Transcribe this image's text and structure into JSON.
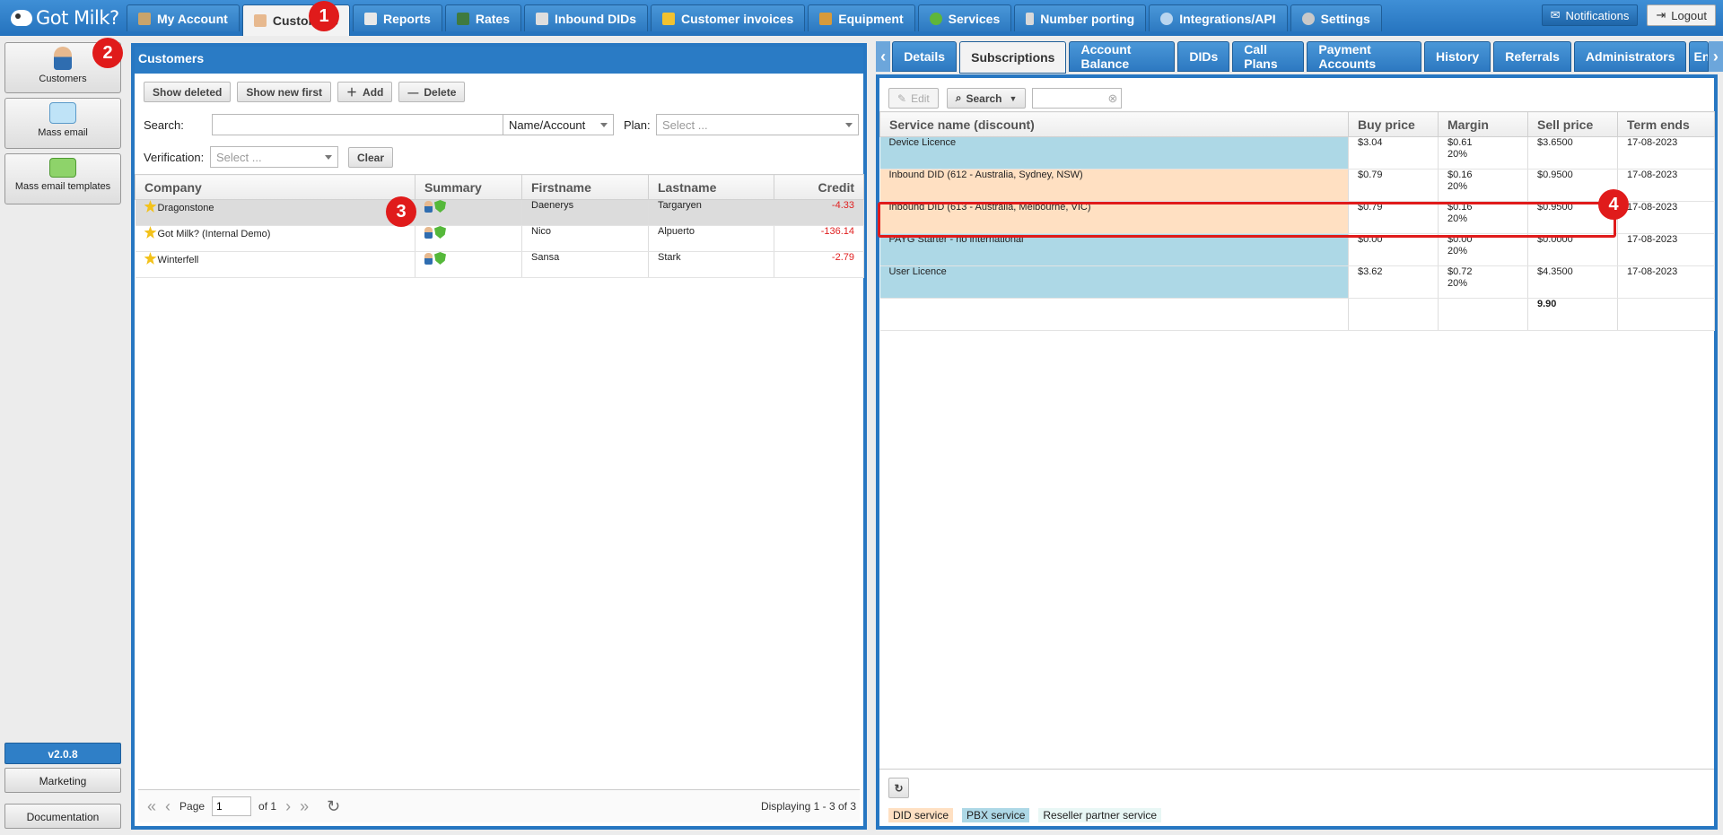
{
  "app": {
    "logo_text": "Got Milk?"
  },
  "top_tabs": [
    {
      "label": "My Account",
      "icon": "account-icon"
    },
    {
      "label": "Customers",
      "icon": "user-icon"
    },
    {
      "label": "Reports",
      "icon": "report-icon"
    },
    {
      "label": "Rates",
      "icon": "rates-icon"
    },
    {
      "label": "Inbound DIDs",
      "icon": "did-icon"
    },
    {
      "label": "Customer invoices",
      "icon": "invoice-icon"
    },
    {
      "label": "Equipment",
      "icon": "box-icon"
    },
    {
      "label": "Services",
      "icon": "services-icon"
    },
    {
      "label": "Number porting",
      "icon": "phone-icon"
    },
    {
      "label": "Integrations/API",
      "icon": "integration-icon"
    },
    {
      "label": "Settings",
      "icon": "gear-icon"
    }
  ],
  "top_right": {
    "notifications": "Notifications",
    "logout": "Logout"
  },
  "left_nav": {
    "items": [
      {
        "label": "Customers",
        "icon": "customers-icon"
      },
      {
        "label": "Mass email",
        "icon": "mass-email-icon"
      },
      {
        "label": "Mass email templates",
        "icon": "email-template-icon"
      }
    ],
    "version": "v2.0.8",
    "marketing": "Marketing",
    "documentation": "Documentation"
  },
  "customers_panel": {
    "title": "Customers",
    "buttons": {
      "show_deleted": "Show deleted",
      "show_new_first": "Show new first",
      "add": "Add",
      "delete": "Delete"
    },
    "search_label": "Search:",
    "search_value": "",
    "search_mode": "Name/Account",
    "plan_label": "Plan:",
    "plan_placeholder": "Select ...",
    "verification_label": "Verification:",
    "verification_placeholder": "Select ...",
    "clear": "Clear",
    "columns": [
      "Company",
      "Summary",
      "Firstname",
      "Lastname",
      "Credit"
    ],
    "rows": [
      {
        "company": "Dragonstone",
        "firstname": "Daenerys",
        "lastname": "Targaryen",
        "credit": "-4.33"
      },
      {
        "company": "Got Milk? (Internal Demo)",
        "firstname": "Nico",
        "lastname": "Alpuerto",
        "credit": "-136.14"
      },
      {
        "company": "Winterfell",
        "firstname": "Sansa",
        "lastname": "Stark",
        "credit": "-2.79"
      }
    ],
    "pager": {
      "page_label": "Page",
      "page": "1",
      "of": "of 1",
      "display": "Displaying 1 - 3 of 3"
    }
  },
  "right_tabs": [
    "Details",
    "Subscriptions",
    "Account Balance",
    "DIDs",
    "Call Plans",
    "Payment Accounts",
    "History",
    "Referrals",
    "Administrators",
    "En"
  ],
  "subscriptions": {
    "toolbar": {
      "edit": "Edit",
      "search": "Search",
      "search_value": ""
    },
    "columns": [
      "Service name (discount)",
      "Buy price",
      "Margin",
      "Sell price",
      "Term ends"
    ],
    "rows": [
      {
        "name": "Device Licence",
        "type": "pbx",
        "buy": "$3.04",
        "margin": "$0.61",
        "margin_pct": "20%",
        "sell": "$3.6500",
        "term": "17-08-2023"
      },
      {
        "name": "Inbound DID (612 - Australia, Sydney, NSW)",
        "type": "did",
        "buy": "$0.79",
        "margin": "$0.16",
        "margin_pct": "20%",
        "sell": "$0.9500",
        "term": "17-08-2023"
      },
      {
        "name": "Inbound DID (613 - Australia, Melbourne, VIC)",
        "type": "did",
        "buy": "$0.79",
        "margin": "$0.16",
        "margin_pct": "20%",
        "sell": "$0.9500",
        "term": "17-08-2023"
      },
      {
        "name": "PAYG Starter - no international",
        "type": "pbx",
        "buy": "$0.00",
        "margin": "$0.00",
        "margin_pct": "20%",
        "sell": "$0.0000",
        "term": "17-08-2023"
      },
      {
        "name": "User Licence",
        "type": "pbx",
        "buy": "$3.62",
        "margin": "$0.72",
        "margin_pct": "20%",
        "sell": "$4.3500",
        "term": "17-08-2023"
      }
    ],
    "total": "9.90",
    "legend": {
      "did": "DID service",
      "pbx": "PBX service",
      "reseller": "Reseller partner service"
    }
  },
  "callouts": [
    "1",
    "2",
    "3",
    "4"
  ],
  "colors": {
    "brand_blue": "#2777c2",
    "did_bg": "#ffe0c2",
    "pbx_bg": "#add8e6",
    "callout_red": "#e01b1b",
    "credit_red": "#e02020"
  }
}
